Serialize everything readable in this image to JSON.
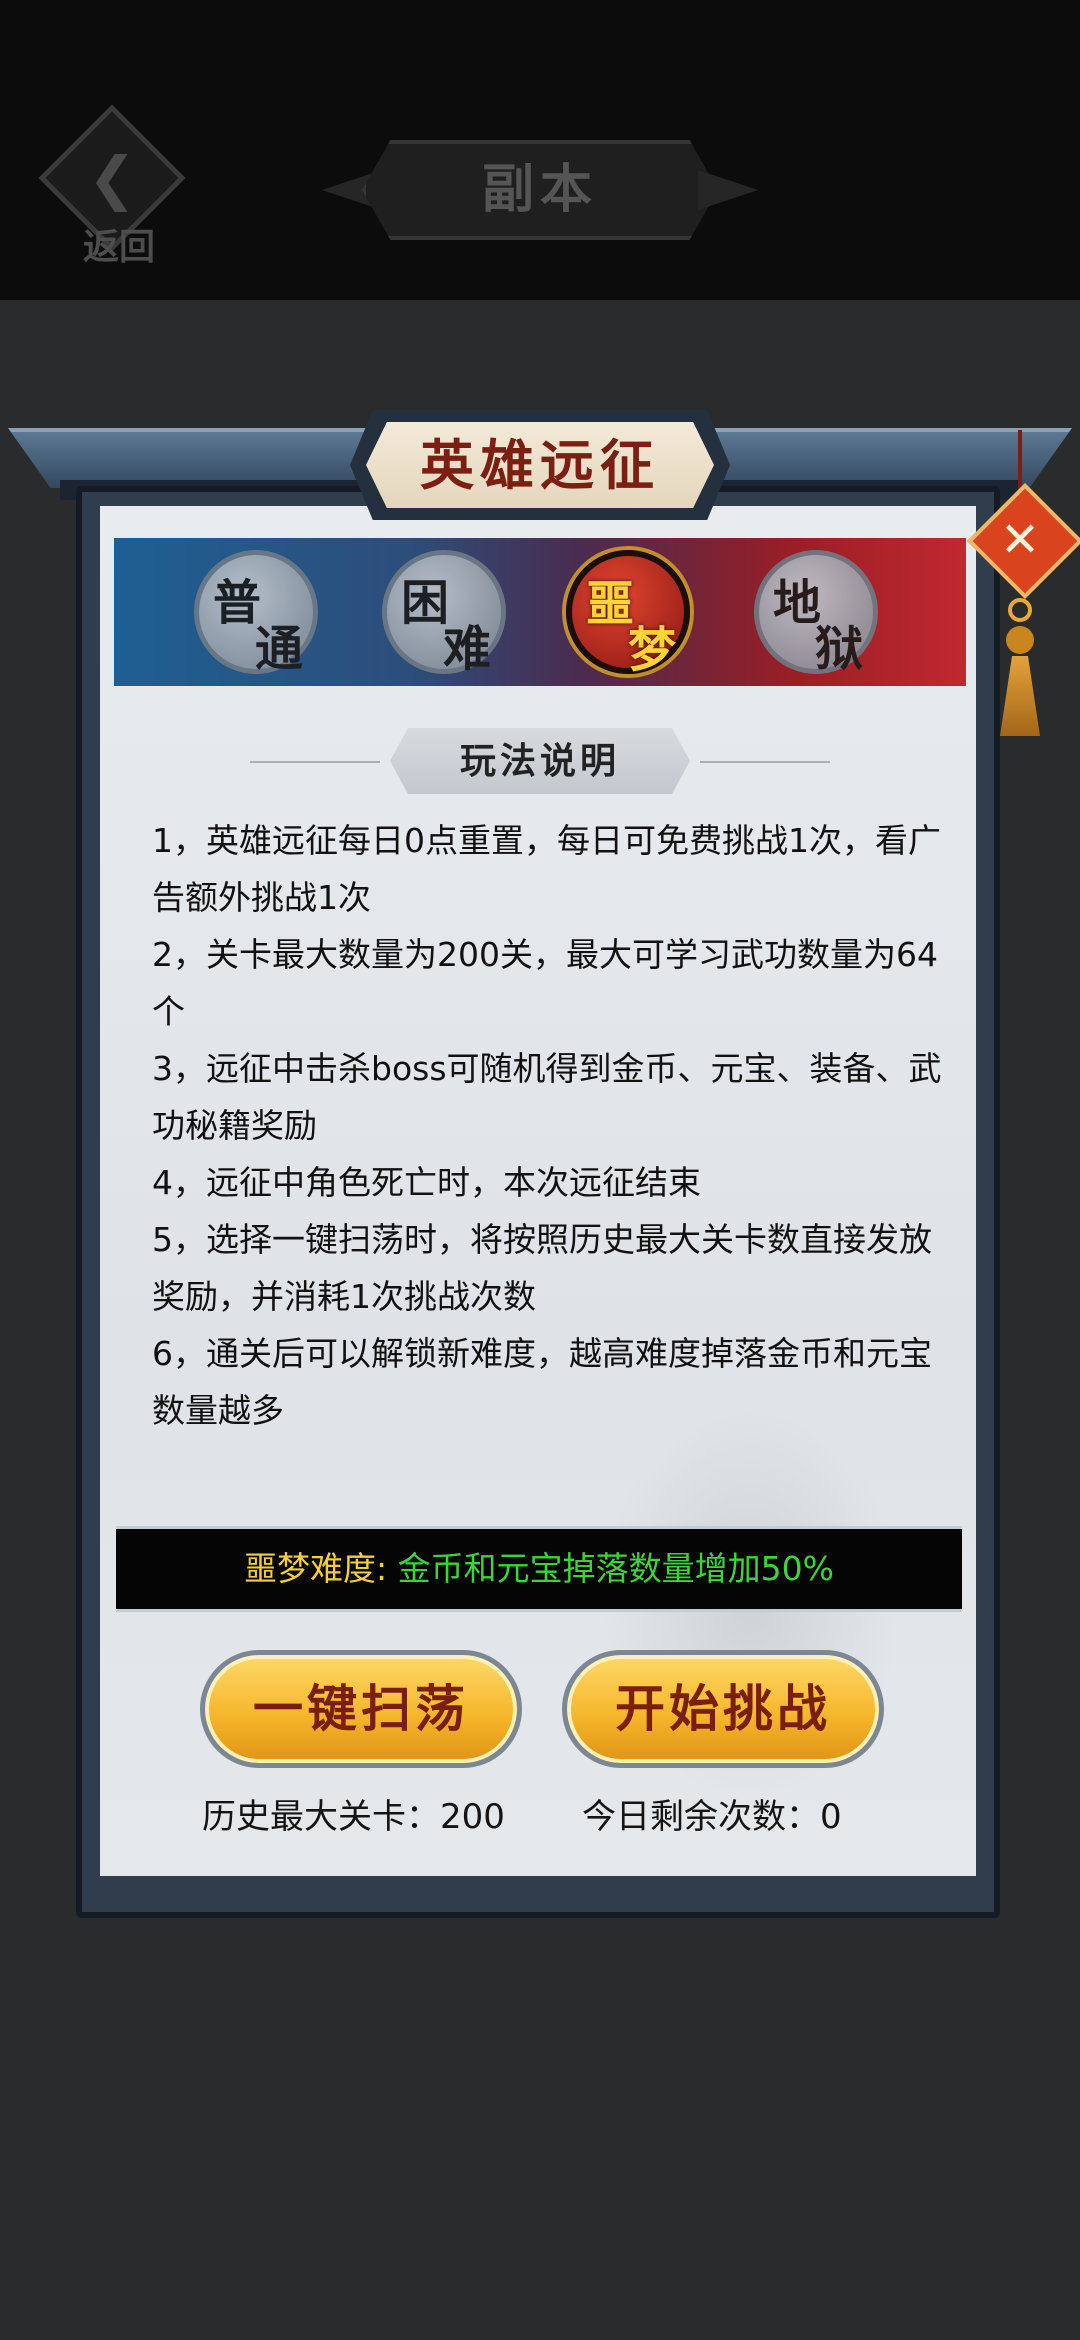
{
  "topbar": {
    "back_label": "返回",
    "title": "副本"
  },
  "panel": {
    "title": "英雄远征",
    "close_icon": "close-icon"
  },
  "difficulty_tabs": [
    {
      "char1": "普",
      "char2": "通",
      "active": false
    },
    {
      "char1": "困",
      "char2": "难",
      "active": false
    },
    {
      "char1": "噩",
      "char2": "梦",
      "active": true
    },
    {
      "char1": "地",
      "char2": "狱",
      "active": false
    }
  ],
  "rules": {
    "heading": "玩法说明",
    "items": [
      "1，英雄远征每日0点重置，每日可免费挑战1次，看广告额外挑战1次",
      "2，关卡最大数量为200关，最大可学习武功数量为64个",
      "3，远征中击杀boss可随机得到金币、元宝、装备、武功秘籍奖励",
      "4，远征中角色死亡时，本次远征结束",
      "5，选择一键扫荡时，将按照历史最大关卡数直接发放奖励，并消耗1次挑战次数",
      "6，通关后可以解锁新难度，越高难度掉落金币和元宝数量越多"
    ]
  },
  "bonus": {
    "label": "噩梦难度:",
    "value": "金币和元宝掉落数量增加50%"
  },
  "actions": {
    "sweep_label": "一键扫荡",
    "start_label": "开始挑战"
  },
  "stats": {
    "history_max": "历史最大关卡：200",
    "remaining_today": "今日剩余次数：0"
  },
  "colors": {
    "accent_gold": "#f6b72c",
    "bonus_label": "#f3cf3c",
    "bonus_value": "#3fd23b",
    "title_red": "#7a1f12"
  }
}
